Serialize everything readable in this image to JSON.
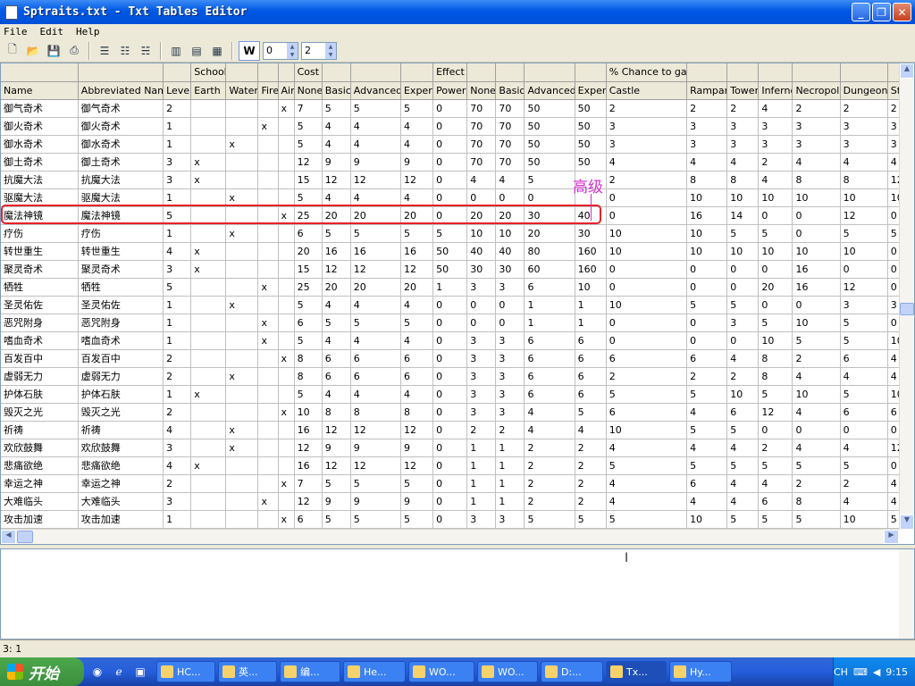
{
  "window": {
    "title": "Sptraits.txt - Txt Tables Editor"
  },
  "menu": [
    "File",
    "Edit",
    "Help"
  ],
  "toolbar": {
    "spin1": "0",
    "spin2": "2",
    "wp_label": "W"
  },
  "grid": {
    "group_headers": {
      "School": "School",
      "Cost": "Cost",
      "Effect": "Effect",
      "Chance": "% Chance to gain"
    },
    "columns": [
      "Name",
      "Abbreviated Name",
      "Level",
      "Earth",
      "Water",
      "Fire",
      "Air",
      "None",
      "Basic",
      "Advanced",
      "Expert",
      "Power",
      "None",
      "Basic",
      "Advanced",
      "Expert",
      "Castle",
      "Rampart",
      "Tower",
      "Inferno",
      "Necropolis",
      "Dungeon",
      "St"
    ],
    "rows": [
      [
        "御气奇术",
        "御气奇术",
        "2",
        "",
        "",
        "",
        "x",
        "7",
        "5",
        "5",
        "5",
        "0",
        "70",
        "70",
        "50",
        "50",
        "2",
        "2",
        "2",
        "4",
        "2",
        "2",
        "2"
      ],
      [
        "御火奇术",
        "御火奇术",
        "1",
        "",
        "",
        "x",
        "",
        "5",
        "4",
        "4",
        "4",
        "0",
        "70",
        "70",
        "50",
        "50",
        "3",
        "3",
        "3",
        "3",
        "3",
        "3",
        "3"
      ],
      [
        "御水奇术",
        "御水奇术",
        "1",
        "",
        "x",
        "",
        "",
        "5",
        "4",
        "4",
        "4",
        "0",
        "70",
        "70",
        "50",
        "50",
        "3",
        "3",
        "3",
        "3",
        "3",
        "3",
        "3"
      ],
      [
        "御土奇术",
        "御土奇术",
        "3",
        "x",
        "",
        "",
        "",
        "12",
        "9",
        "9",
        "9",
        "0",
        "70",
        "70",
        "50",
        "50",
        "4",
        "4",
        "4",
        "2",
        "4",
        "4",
        "4"
      ],
      [
        "抗魔大法",
        "抗魔大法",
        "3",
        "x",
        "",
        "",
        "",
        "15",
        "12",
        "12",
        "12",
        "0",
        "4",
        "4",
        "5",
        "",
        "2",
        "8",
        "8",
        "4",
        "8",
        "8",
        "12"
      ],
      [
        "驱魔大法",
        "驱魔大法",
        "1",
        "",
        "x",
        "",
        "",
        "5",
        "4",
        "4",
        "4",
        "0",
        "0",
        "0",
        "0",
        "",
        "0",
        "10",
        "10",
        "10",
        "10",
        "10",
        "10"
      ],
      [
        "魔法神镜",
        "魔法神镜",
        "5",
        "",
        "",
        "",
        "x",
        "25",
        "20",
        "20",
        "20",
        "0",
        "20",
        "20",
        "30",
        "40",
        "0",
        "16",
        "14",
        "0",
        "0",
        "12",
        "0"
      ],
      [
        "疗伤",
        "疗伤",
        "1",
        "",
        "x",
        "",
        "",
        "6",
        "5",
        "5",
        "5",
        "5",
        "10",
        "10",
        "20",
        "30",
        "10",
        "10",
        "5",
        "5",
        "0",
        "5",
        "5"
      ],
      [
        "转世重生",
        "转世重生",
        "4",
        "x",
        "",
        "",
        "",
        "20",
        "16",
        "16",
        "16",
        "50",
        "40",
        "40",
        "80",
        "160",
        "10",
        "10",
        "10",
        "10",
        "10",
        "10",
        "0"
      ],
      [
        "聚灵奇术",
        "聚灵奇术",
        "3",
        "x",
        "",
        "",
        "",
        "15",
        "12",
        "12",
        "12",
        "50",
        "30",
        "30",
        "60",
        "160",
        "0",
        "0",
        "0",
        "0",
        "16",
        "0",
        "0"
      ],
      [
        "牺牲",
        "牺牲",
        "5",
        "",
        "",
        "x",
        "",
        "25",
        "20",
        "20",
        "20",
        "1",
        "3",
        "3",
        "6",
        "10",
        "0",
        "0",
        "0",
        "20",
        "16",
        "12",
        "0"
      ],
      [
        "圣灵佑佐",
        "圣灵佑佐",
        "1",
        "",
        "x",
        "",
        "",
        "5",
        "4",
        "4",
        "4",
        "0",
        "0",
        "0",
        "1",
        "1",
        "10",
        "5",
        "5",
        "0",
        "0",
        "3",
        "3"
      ],
      [
        "恶咒附身",
        "恶咒附身",
        "1",
        "",
        "",
        "x",
        "",
        "6",
        "5",
        "5",
        "5",
        "0",
        "0",
        "0",
        "1",
        "1",
        "0",
        "0",
        "3",
        "5",
        "10",
        "5",
        "0"
      ],
      [
        "嗜血奇术",
        "嗜血奇术",
        "1",
        "",
        "",
        "x",
        "",
        "5",
        "4",
        "4",
        "4",
        "0",
        "3",
        "3",
        "6",
        "6",
        "0",
        "0",
        "0",
        "10",
        "5",
        "5",
        "10"
      ],
      [
        "百发百中",
        "百发百中",
        "2",
        "",
        "",
        "",
        "x",
        "8",
        "6",
        "6",
        "6",
        "0",
        "3",
        "3",
        "6",
        "6",
        "6",
        "6",
        "4",
        "8",
        "2",
        "6",
        "4"
      ],
      [
        "虚弱无力",
        "虚弱无力",
        "2",
        "",
        "x",
        "",
        "",
        "8",
        "6",
        "6",
        "6",
        "0",
        "3",
        "3",
        "6",
        "6",
        "2",
        "2",
        "2",
        "8",
        "4",
        "4",
        "4"
      ],
      [
        "护体石肤",
        "护体石肤",
        "1",
        "x",
        "",
        "",
        "",
        "5",
        "4",
        "4",
        "4",
        "0",
        "3",
        "3",
        "6",
        "6",
        "5",
        "5",
        "10",
        "5",
        "10",
        "5",
        "10"
      ],
      [
        "毁灭之光",
        "毁灭之光",
        "2",
        "",
        "",
        "",
        "x",
        "10",
        "8",
        "8",
        "8",
        "0",
        "3",
        "3",
        "4",
        "5",
        "6",
        "4",
        "6",
        "12",
        "4",
        "6",
        "6"
      ],
      [
        "祈祷",
        "祈祷",
        "4",
        "",
        "x",
        "",
        "",
        "16",
        "12",
        "12",
        "12",
        "0",
        "2",
        "2",
        "4",
        "4",
        "10",
        "5",
        "5",
        "0",
        "0",
        "0",
        "0"
      ],
      [
        "欢欣鼓舞",
        "欢欣鼓舞",
        "3",
        "",
        "x",
        "",
        "",
        "12",
        "9",
        "9",
        "9",
        "0",
        "1",
        "1",
        "2",
        "2",
        "4",
        "4",
        "4",
        "2",
        "4",
        "4",
        "12"
      ],
      [
        "悲痛欲绝",
        "悲痛欲绝",
        "4",
        "x",
        "",
        "",
        "",
        "16",
        "12",
        "12",
        "12",
        "0",
        "1",
        "1",
        "2",
        "2",
        "5",
        "5",
        "5",
        "5",
        "5",
        "5",
        "0"
      ],
      [
        "幸运之神",
        "幸运之神",
        "2",
        "",
        "",
        "",
        "x",
        "7",
        "5",
        "5",
        "5",
        "0",
        "1",
        "1",
        "2",
        "2",
        "4",
        "6",
        "4",
        "4",
        "2",
        "2",
        "4"
      ],
      [
        "大难临头",
        "大难临头",
        "3",
        "",
        "",
        "x",
        "",
        "12",
        "9",
        "9",
        "9",
        "0",
        "1",
        "1",
        "2",
        "2",
        "4",
        "4",
        "4",
        "6",
        "8",
        "4",
        "4"
      ],
      [
        "攻击加速",
        "攻击加速",
        "1",
        "",
        "",
        "",
        "x",
        "6",
        "5",
        "5",
        "5",
        "0",
        "3",
        "3",
        "5",
        "5",
        "5",
        "10",
        "5",
        "5",
        "5",
        "10",
        "5"
      ]
    ]
  },
  "annotation": "高级",
  "status": {
    "position": "3: 1"
  },
  "taskbar": {
    "start": "开始",
    "tasks": [
      "HC...",
      "英...",
      "编...",
      "He...",
      "WO...",
      "WO...",
      "D:...",
      "Tx...",
      "Hy..."
    ],
    "lang": "CH",
    "clock": "9:15"
  }
}
